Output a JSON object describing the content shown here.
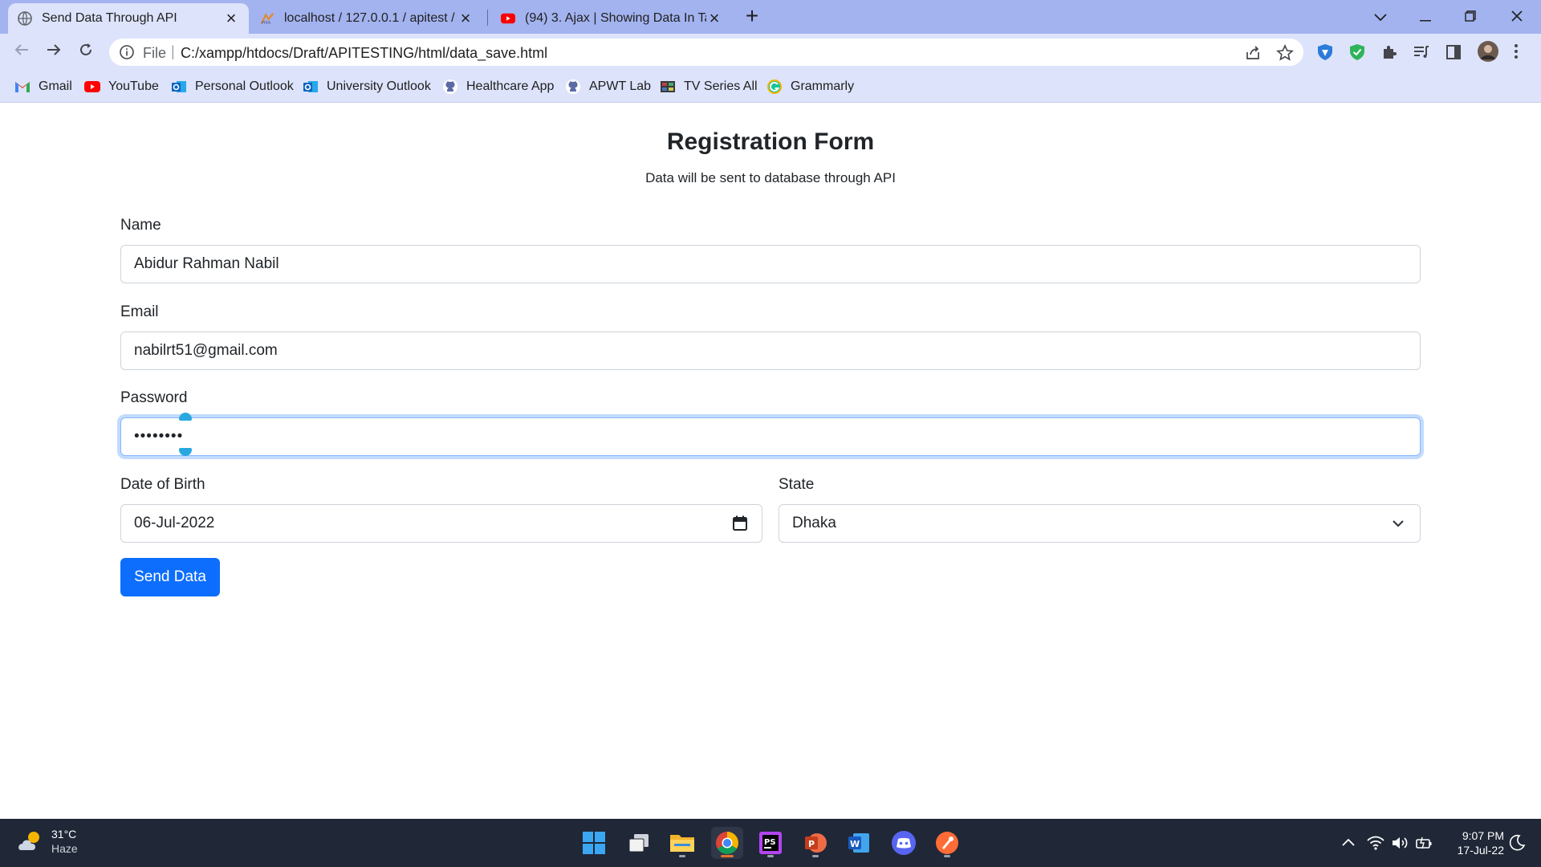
{
  "browser": {
    "tabs": [
      {
        "title": "Send Data Through API",
        "active": true
      },
      {
        "title": "localhost / 127.0.0.1 / apitest / st",
        "active": false
      },
      {
        "title": "(94) 3. Ajax | Showing Data In Tab",
        "active": false
      }
    ],
    "address": {
      "scheme_label": "File",
      "url": "C:/xampp/htdocs/Draft/APITESTING/html/data_save.html"
    },
    "bookmarks": [
      {
        "label": "Gmail",
        "icon": "gmail-icon"
      },
      {
        "label": "YouTube",
        "icon": "youtube-icon"
      },
      {
        "label": "Personal Outlook",
        "icon": "outlook-icon"
      },
      {
        "label": "University Outlook",
        "icon": "outlook-icon"
      },
      {
        "label": "Healthcare App",
        "icon": "github-icon"
      },
      {
        "label": "APWT Lab",
        "icon": "github-icon"
      },
      {
        "label": "TV Series All",
        "icon": "tv-icon"
      },
      {
        "label": "Grammarly",
        "icon": "grammarly-icon"
      }
    ]
  },
  "form": {
    "title": "Registration Form",
    "subtitle": "Data will be sent to database through API",
    "name": {
      "label": "Name",
      "value": "Abidur Rahman Nabil"
    },
    "email": {
      "label": "Email",
      "value": "nabilrt51@gmail.com"
    },
    "password": {
      "label": "Password",
      "value": "••••••••"
    },
    "dob": {
      "label": "Date of Birth",
      "value": "06-Jul-2022"
    },
    "state": {
      "label": "State",
      "value": "Dhaka"
    },
    "submit_label": "Send Data"
  },
  "taskbar": {
    "weather": {
      "temp": "31°C",
      "condition": "Haze"
    },
    "time": "9:07 PM",
    "date": "17-Jul-22"
  },
  "colors": {
    "tab_strip": "#a3b3ef",
    "toolbar": "#dde3fb",
    "primary_button": "#0d6efd",
    "taskbar": "#202737"
  }
}
